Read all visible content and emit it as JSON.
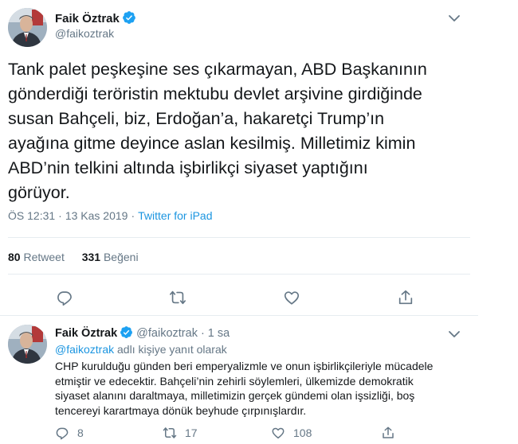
{
  "main_tweet": {
    "author_name": "Faik Öztrak",
    "author_handle": "@faikoztrak",
    "text_lines": [
      "Tank palet peşkeşine ses çıkarmayan, ABD Başkanının",
      "gönderdiği teröristin mektubu devlet arşivine girdiğinde",
      "susan Bahçeli, biz, Erdoğan’a,  hakaretçi Trump’ın",
      "ayağına gitme deyince aslan kesilmiş. Milletimiz kimin",
      "ABD’nin telkini altında işbirlikçi siyaset yaptığını",
      "görüyor."
    ],
    "time": "ÖS 12:31",
    "date": "13 Kas 2019",
    "separator": "·",
    "source": "Twitter for iPad",
    "retweet_count": "80",
    "retweet_label": "Retweet",
    "like_count": "331",
    "like_label": "Beğeni"
  },
  "reply_tweet": {
    "author_name": "Faik Öztrak",
    "author_handle": "@faikoztrak",
    "separator": "·",
    "time_ago": "1 sa",
    "replying_to_mention": "@faikoztrak",
    "replying_to_suffix": "adlı kişiye yanıt olarak",
    "text_lines": [
      "CHP kurulduğu günden beri emperyalizmle ve onun işbirlikçileriyle mücadele",
      "etmiştir ve edecektir. Bahçeli’nin zehirli söylemleri, ülkemizde demokratik",
      "siyaset alanını daraltmaya, milletimizin gerçek gündemi olan işsizliği, boş",
      "tencereyi karartmaya dönük beyhude çırpınışlardır."
    ],
    "reply_count": "8",
    "retweet_count": "17",
    "like_count": "108"
  },
  "icons": {
    "verified": "verified-badge-icon",
    "caret": "chevron-down-icon",
    "reply": "reply-icon",
    "retweet": "retweet-icon",
    "like": "heart-icon",
    "share": "share-icon"
  },
  "colors": {
    "text_primary": "#14171a",
    "text_secondary": "#657786",
    "link": "#1b95e0",
    "verified": "#1da1f2",
    "divider": "#e6ecf0"
  }
}
